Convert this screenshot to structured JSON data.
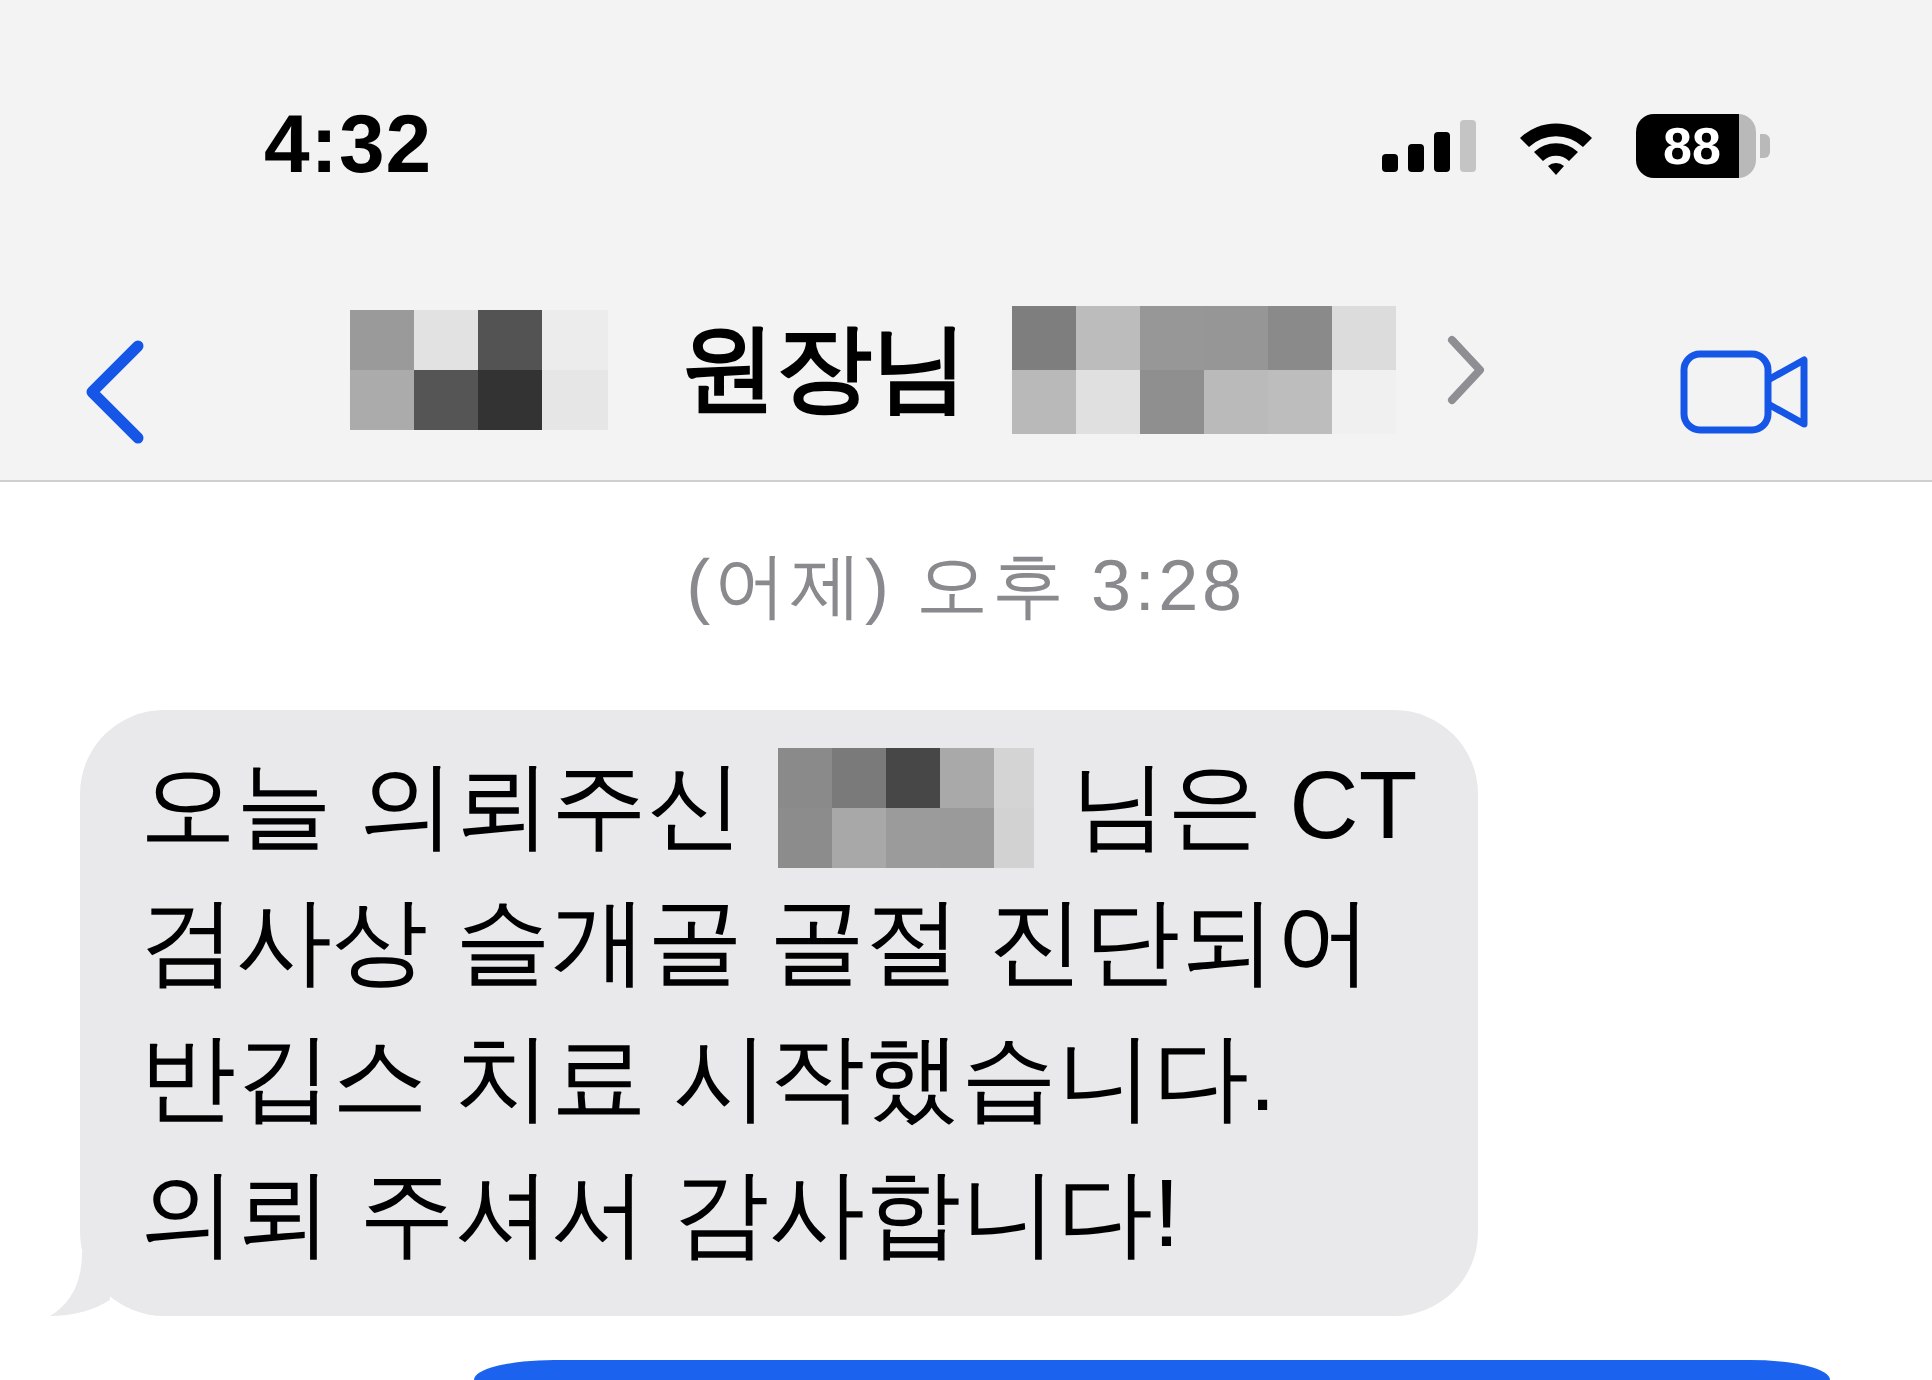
{
  "status_bar": {
    "time": "4:32",
    "battery": "88"
  },
  "header": {
    "title_parts": [
      {
        "kind": "mosaic"
      },
      {
        "kind": "text",
        "text": "원장님"
      },
      {
        "kind": "mosaic"
      }
    ]
  },
  "conversation": {
    "timestamp": "(어제) 오후 3:28",
    "messages": [
      {
        "kind": "incoming",
        "lines": [
          [
            {
              "kind": "text",
              "text": "오늘 의뢰주신"
            },
            {
              "kind": "mosaic"
            },
            {
              "kind": "text",
              "text": "님은 CT"
            }
          ],
          [
            {
              "kind": "text",
              "text": "검사상 슬개골 골절 진단되어"
            }
          ],
          [
            {
              "kind": "text",
              "text": "반깁스 치료 시작했습니다."
            }
          ],
          [
            {
              "kind": "text",
              "text": "의뢰 주셔서 감사합니다!"
            }
          ]
        ]
      },
      {
        "kind": "outgoing"
      }
    ]
  }
}
